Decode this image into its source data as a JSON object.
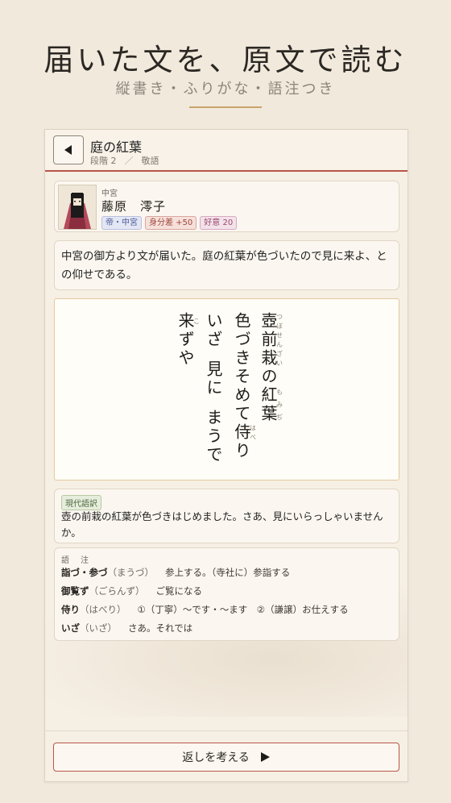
{
  "hero": {
    "title": "届いた文を、原文で読む",
    "subtitle": "縦書き・ふりがな・語注つき"
  },
  "topbar": {
    "back_icon": "triangle-left",
    "title": "庭の紅葉",
    "stage": "段階 2",
    "separator": "／",
    "tag": "敬語"
  },
  "character": {
    "role": "中宮",
    "name": "藤原　澪子",
    "badges": {
      "rank": "帝・中宮",
      "diff": "身分差 +50",
      "favor": "好意 20"
    }
  },
  "message": "中宮の御方より文が届いた。庭の紅葉が色づいたので見に来よ、との仰せである。",
  "poem": {
    "line1": {
      "w1": "壺前栽",
      "r1": "つぼせんざい",
      "w2": "の",
      "w3": "紅葉",
      "r3": "もみぢ"
    },
    "line2": {
      "w1": "色づきそめて",
      "w2": "侍",
      "r2": "はべ",
      "w3": "り"
    },
    "line3": {
      "w1": "いざ",
      "w2": "見に",
      "w3": "まうで"
    },
    "line4": {
      "w1": "来",
      "r1": "こ",
      "w2": "ずや"
    }
  },
  "translation": {
    "label": "現代語訳",
    "text": "壺の前栽の紅葉が色づきはじめました。さあ、見にいらっしゃいませんか。"
  },
  "glossary": {
    "heading": "語　注",
    "items": [
      {
        "word": "詣づ・参づ",
        "reading": "（まうづ）",
        "def": "参上する。（寺社に）参詣する"
      },
      {
        "word": "御覧ず",
        "reading": "（ごらんず）",
        "def": "ご覧になる"
      },
      {
        "word": "侍り",
        "reading": "（はべり）",
        "def": "①（丁寧）～です・～ます　②（謙譲）お仕えする"
      },
      {
        "word": "いざ",
        "reading": "（いざ）",
        "def": "さあ。それでは"
      }
    ]
  },
  "action": {
    "label": "返しを考える",
    "icon": "play-triangle-right"
  },
  "colors": {
    "accent_red": "#b8564a",
    "gold_rule": "#c9a46a",
    "background": "#f1e9dc"
  }
}
